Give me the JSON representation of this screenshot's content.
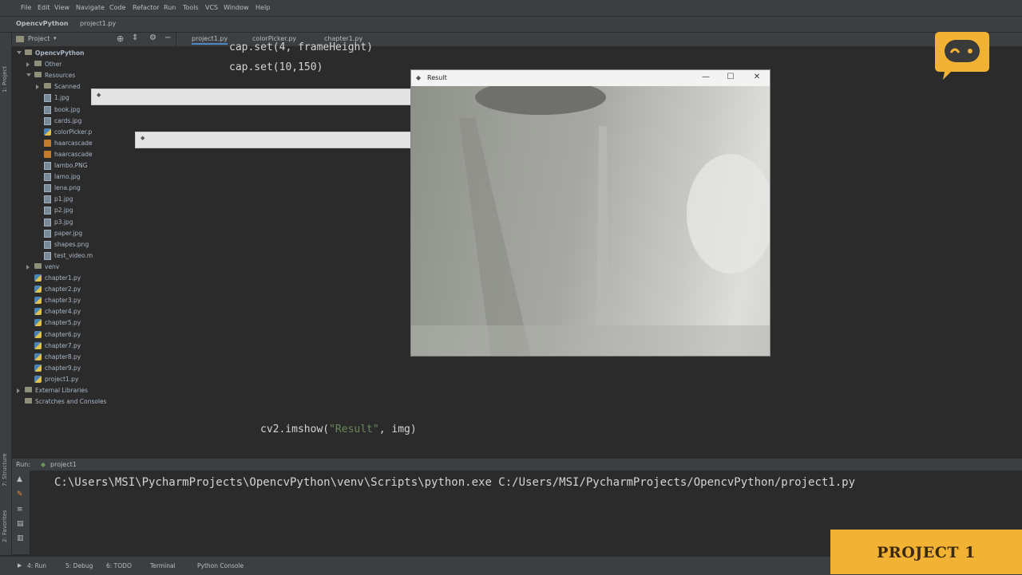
{
  "menu": [
    "File",
    "Edit",
    "View",
    "Navigate",
    "Code",
    "Refactor",
    "Run",
    "Tools",
    "VCS",
    "Window",
    "Help"
  ],
  "breadcrumb": [
    "OpencvPython",
    "project1.py"
  ],
  "project_panel": {
    "title": "Project",
    "tree": [
      {
        "label": "OpencvPython",
        "kind": "folder",
        "expanded": true
      },
      {
        "label": "Other",
        "kind": "folder",
        "expanded": false
      },
      {
        "label": "Resources",
        "kind": "folder",
        "expanded": true
      },
      {
        "label": "Scanned",
        "kind": "folder",
        "expanded": false
      },
      {
        "label": "1.jpg",
        "kind": "image"
      },
      {
        "label": "book.jpg",
        "kind": "image"
      },
      {
        "label": "cards.jpg",
        "kind": "image"
      },
      {
        "label": "colorPicker.p",
        "kind": "python"
      },
      {
        "label": "haarcascade",
        "kind": "xml"
      },
      {
        "label": "haarcascade",
        "kind": "xml"
      },
      {
        "label": "lambo.PNG",
        "kind": "image"
      },
      {
        "label": "lamo.jpg",
        "kind": "image"
      },
      {
        "label": "lena.png",
        "kind": "image"
      },
      {
        "label": "p1.jpg",
        "kind": "image"
      },
      {
        "label": "p2.jpg",
        "kind": "image"
      },
      {
        "label": "p3.jpg",
        "kind": "image"
      },
      {
        "label": "paper.jpg",
        "kind": "image"
      },
      {
        "label": "shapes.png",
        "kind": "image"
      },
      {
        "label": "test_video.m",
        "kind": "image"
      },
      {
        "label": "venv",
        "kind": "folder",
        "expanded": false
      },
      {
        "label": "chapter1.py",
        "kind": "python"
      },
      {
        "label": "chapter2.py",
        "kind": "python"
      },
      {
        "label": "chapter3.py",
        "kind": "python"
      },
      {
        "label": "chapter4.py",
        "kind": "python"
      },
      {
        "label": "chapter5.py",
        "kind": "python"
      },
      {
        "label": "chapter6.py",
        "kind": "python"
      },
      {
        "label": "chapter7.py",
        "kind": "python"
      },
      {
        "label": "chapter8.py",
        "kind": "python"
      },
      {
        "label": "chapter9.py",
        "kind": "python"
      },
      {
        "label": "project1.py",
        "kind": "python"
      },
      {
        "label": "External Libraries",
        "kind": "folder",
        "expanded": false
      },
      {
        "label": "Scratches and Consoles",
        "kind": "folder"
      }
    ]
  },
  "tabs": [
    "project1.py",
    "colorPicker.py",
    "chapter1.py"
  ],
  "code": {
    "line1": "cap.set(4, frameHeight)",
    "line2": "cap.set(10,150)",
    "line3_pre": "cv2.imshow(",
    "line3_str": "\"Result\"",
    "line3_post": ", img)"
  },
  "result_window": {
    "title": "Result",
    "min": "—",
    "max": "☐",
    "close": "✕"
  },
  "run_panel": {
    "label": "Run:",
    "config": "project1",
    "output": "C:\\Users\\MSI\\PycharmProjects\\OpencvPython\\venv\\Scripts\\python.exe C:/Users/MSI/PycharmProjects/OpencvPython/project1.py"
  },
  "left_stripe": {
    "project": "1: Project",
    "structure": "7: Structure",
    "favorites": "2: Favorites"
  },
  "bottom_bar": [
    "4: Run",
    "5: Debug",
    "6: TODO",
    "Terminal",
    "Python Console"
  ],
  "banner": "PROJECT 1"
}
